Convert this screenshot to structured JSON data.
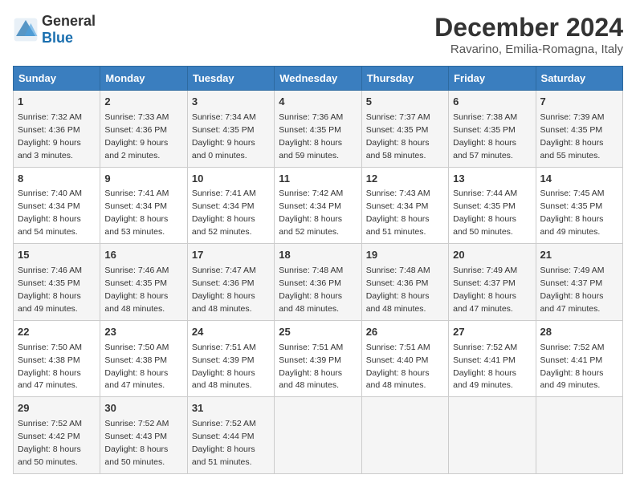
{
  "header": {
    "logo_general": "General",
    "logo_blue": "Blue",
    "title": "December 2024",
    "subtitle": "Ravarino, Emilia-Romagna, Italy"
  },
  "calendar": {
    "weekdays": [
      "Sunday",
      "Monday",
      "Tuesday",
      "Wednesday",
      "Thursday",
      "Friday",
      "Saturday"
    ],
    "weeks": [
      [
        {
          "day": "1",
          "sunrise": "7:32 AM",
          "sunset": "4:36 PM",
          "daylight": "9 hours and 3 minutes."
        },
        {
          "day": "2",
          "sunrise": "7:33 AM",
          "sunset": "4:36 PM",
          "daylight": "9 hours and 2 minutes."
        },
        {
          "day": "3",
          "sunrise": "7:34 AM",
          "sunset": "4:35 PM",
          "daylight": "9 hours and 0 minutes."
        },
        {
          "day": "4",
          "sunrise": "7:36 AM",
          "sunset": "4:35 PM",
          "daylight": "8 hours and 59 minutes."
        },
        {
          "day": "5",
          "sunrise": "7:37 AM",
          "sunset": "4:35 PM",
          "daylight": "8 hours and 58 minutes."
        },
        {
          "day": "6",
          "sunrise": "7:38 AM",
          "sunset": "4:35 PM",
          "daylight": "8 hours and 57 minutes."
        },
        {
          "day": "7",
          "sunrise": "7:39 AM",
          "sunset": "4:35 PM",
          "daylight": "8 hours and 55 minutes."
        }
      ],
      [
        {
          "day": "8",
          "sunrise": "7:40 AM",
          "sunset": "4:34 PM",
          "daylight": "8 hours and 54 minutes."
        },
        {
          "day": "9",
          "sunrise": "7:41 AM",
          "sunset": "4:34 PM",
          "daylight": "8 hours and 53 minutes."
        },
        {
          "day": "10",
          "sunrise": "7:41 AM",
          "sunset": "4:34 PM",
          "daylight": "8 hours and 52 minutes."
        },
        {
          "day": "11",
          "sunrise": "7:42 AM",
          "sunset": "4:34 PM",
          "daylight": "8 hours and 52 minutes."
        },
        {
          "day": "12",
          "sunrise": "7:43 AM",
          "sunset": "4:34 PM",
          "daylight": "8 hours and 51 minutes."
        },
        {
          "day": "13",
          "sunrise": "7:44 AM",
          "sunset": "4:35 PM",
          "daylight": "8 hours and 50 minutes."
        },
        {
          "day": "14",
          "sunrise": "7:45 AM",
          "sunset": "4:35 PM",
          "daylight": "8 hours and 49 minutes."
        }
      ],
      [
        {
          "day": "15",
          "sunrise": "7:46 AM",
          "sunset": "4:35 PM",
          "daylight": "8 hours and 49 minutes."
        },
        {
          "day": "16",
          "sunrise": "7:46 AM",
          "sunset": "4:35 PM",
          "daylight": "8 hours and 48 minutes."
        },
        {
          "day": "17",
          "sunrise": "7:47 AM",
          "sunset": "4:36 PM",
          "daylight": "8 hours and 48 minutes."
        },
        {
          "day": "18",
          "sunrise": "7:48 AM",
          "sunset": "4:36 PM",
          "daylight": "8 hours and 48 minutes."
        },
        {
          "day": "19",
          "sunrise": "7:48 AM",
          "sunset": "4:36 PM",
          "daylight": "8 hours and 48 minutes."
        },
        {
          "day": "20",
          "sunrise": "7:49 AM",
          "sunset": "4:37 PM",
          "daylight": "8 hours and 47 minutes."
        },
        {
          "day": "21",
          "sunrise": "7:49 AM",
          "sunset": "4:37 PM",
          "daylight": "8 hours and 47 minutes."
        }
      ],
      [
        {
          "day": "22",
          "sunrise": "7:50 AM",
          "sunset": "4:38 PM",
          "daylight": "8 hours and 47 minutes."
        },
        {
          "day": "23",
          "sunrise": "7:50 AM",
          "sunset": "4:38 PM",
          "daylight": "8 hours and 47 minutes."
        },
        {
          "day": "24",
          "sunrise": "7:51 AM",
          "sunset": "4:39 PM",
          "daylight": "8 hours and 48 minutes."
        },
        {
          "day": "25",
          "sunrise": "7:51 AM",
          "sunset": "4:39 PM",
          "daylight": "8 hours and 48 minutes."
        },
        {
          "day": "26",
          "sunrise": "7:51 AM",
          "sunset": "4:40 PM",
          "daylight": "8 hours and 48 minutes."
        },
        {
          "day": "27",
          "sunrise": "7:52 AM",
          "sunset": "4:41 PM",
          "daylight": "8 hours and 49 minutes."
        },
        {
          "day": "28",
          "sunrise": "7:52 AM",
          "sunset": "4:41 PM",
          "daylight": "8 hours and 49 minutes."
        }
      ],
      [
        {
          "day": "29",
          "sunrise": "7:52 AM",
          "sunset": "4:42 PM",
          "daylight": "8 hours and 50 minutes."
        },
        {
          "day": "30",
          "sunrise": "7:52 AM",
          "sunset": "4:43 PM",
          "daylight": "8 hours and 50 minutes."
        },
        {
          "day": "31",
          "sunrise": "7:52 AM",
          "sunset": "4:44 PM",
          "daylight": "8 hours and 51 minutes."
        },
        null,
        null,
        null,
        null
      ]
    ]
  }
}
